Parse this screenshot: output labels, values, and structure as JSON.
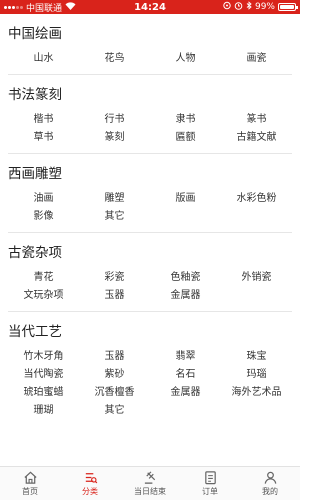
{
  "status": {
    "carrier": "中国联通",
    "time": "14:24",
    "battery": "99%",
    "battery_level": 0.99
  },
  "sections": [
    {
      "title": "中国绘画",
      "items": [
        "山水",
        "花鸟",
        "人物",
        "画瓷"
      ]
    },
    {
      "title": "书法篆刻",
      "items": [
        "楷书",
        "行书",
        "隶书",
        "篆书",
        "草书",
        "篆刻",
        "匾额",
        "古籍文献"
      ]
    },
    {
      "title": "西画雕塑",
      "items": [
        "油画",
        "雕塑",
        "版画",
        "水彩色粉",
        "影像",
        "其它"
      ]
    },
    {
      "title": "古瓷杂项",
      "items": [
        "青花",
        "彩瓷",
        "色釉瓷",
        "外销瓷",
        "文玩杂项",
        "玉器",
        "金属器"
      ]
    },
    {
      "title": "当代工艺",
      "items": [
        "竹木牙角",
        "玉器",
        "翡翠",
        "珠宝",
        "当代陶瓷",
        "紫砂",
        "名石",
        "玛瑙",
        "琥珀蜜蜡",
        "沉香檀香",
        "金属器",
        "海外艺术品",
        "珊瑚",
        "其它"
      ]
    }
  ],
  "tabbar": {
    "items": [
      {
        "label": "首页",
        "icon": "home-icon",
        "active": false
      },
      {
        "label": "分类",
        "icon": "category-icon",
        "active": true
      },
      {
        "label": "当日结束",
        "icon": "gavel-icon",
        "active": false
      },
      {
        "label": "订单",
        "icon": "order-icon",
        "active": false
      },
      {
        "label": "我的",
        "icon": "user-icon",
        "active": false
      }
    ]
  },
  "colors": {
    "accent": "#d9231b",
    "text": "#333333",
    "divider": "#e6e6e6"
  }
}
